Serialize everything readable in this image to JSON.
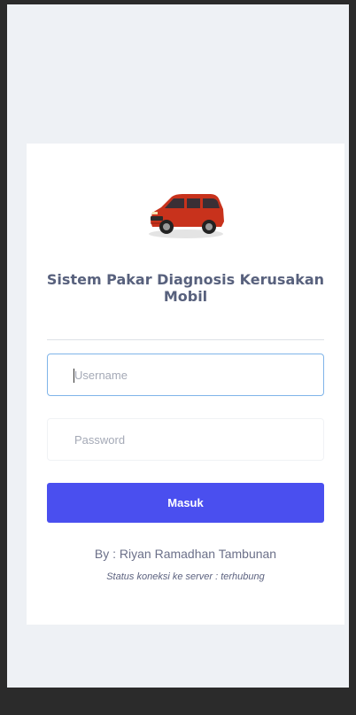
{
  "login": {
    "title": "Sistem Pakar Diagnosis Kerusakan Mobil",
    "car_image_icon": "red-minivan-car-image",
    "username_placeholder": "Username",
    "password_placeholder": "Password",
    "submit_label": "Masuk",
    "author": "By : Riyan Ramadhan Tambunan",
    "status": "Status koneksi ke server : terhubung"
  },
  "colors": {
    "page_background": "#eef1f5",
    "card_background": "#ffffff",
    "button": "#4a4fef",
    "title_text": "#58617d",
    "focus_border": "#7fb4e9",
    "car_body": "#c8321c"
  }
}
